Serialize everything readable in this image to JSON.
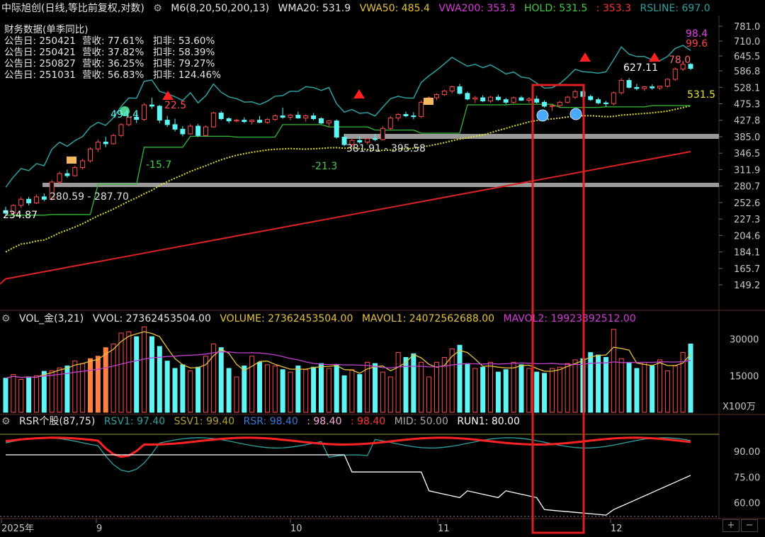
{
  "colors": {
    "up": "#ff4d4d",
    "down": "#5ff5f5",
    "wma20": "#dddd33",
    "vwa50": "#e6c33a",
    "vwa200": "#d83adb",
    "hold": "#44cc44",
    "hold_line": "#33bb33",
    "rsline": "#2fa0a0",
    "ma200": "#dd2222",
    "highlight": "#e02020",
    "white": "#ffffff",
    "grey": "#9a9a9a"
  },
  "header": {
    "title": "中际旭创(日线,等比前复权,对数)",
    "indicator": "M6(8,20,50,200,13)",
    "wma20": "WMA20: 531.9",
    "vwa50": "VWA50: 485.4",
    "vwa200": "VWA200: 353.3",
    "hold": "HOLD: 531.5",
    "hold2": ": 353.3",
    "rsline": "RSLINE: 697.0"
  },
  "financial": {
    "title": "财务数据(单季同比)",
    "rows": [
      {
        "date": "公告日: 250421",
        "rev": "营收: 77.61%",
        "np": "扣非: 53.60%"
      },
      {
        "date": "公告日: 250421",
        "rev": "营收: 37.82%",
        "np": "扣非: 58.39%"
      },
      {
        "date": "公告日: 250827",
        "rev": "营收: 36.25%",
        "np": "扣非: 79.27%"
      },
      {
        "date": "公告日: 251031",
        "rev": "营收: 56.83%",
        "np": "扣非: 124.46%"
      }
    ]
  },
  "volume_header": {
    "label": "VOL_金(3,21)",
    "vvol": "VVOL: 27362453504.00",
    "volume": "VOLUME: 27362453504.00",
    "mavol1": "MAVOL1: 24072562688.00",
    "mavol2": "MAVOL2: 19923392512.00"
  },
  "rsr_header": {
    "label": "RSR个股(87,75)",
    "rsv1": "RSV1: 97.40",
    "ssv1": "SSV1: 99.40",
    "rsr": "RSR: 98.40",
    "v4": ": 98.40",
    "v5": ": 98.40",
    "mid": "MID: 50.00",
    "run1": "RUN1: 80.00"
  },
  "price_axis": [
    "781.0",
    "710.0",
    "645.5",
    "586.8",
    "528.1",
    "475.3",
    "427.8",
    "385.0",
    "346.5",
    "311.9",
    "280.7",
    "252.6",
    "227.3",
    "204.6",
    "184.1",
    "165.7",
    "149.2"
  ],
  "vol_axis": [
    "30000",
    "15000"
  ],
  "vol_unit": "X100万",
  "rsr_axis": [
    "90.00",
    "75.00",
    "60.00"
  ],
  "date_axis": [
    "2025年",
    "9",
    "10",
    "11",
    "12"
  ],
  "nav_buttons": [
    "+",
    "−"
  ],
  "annotations": {
    "low_start": "234.87",
    "zone1": "280.59 - 287.70",
    "zone2": "381.91 - 395.58",
    "high_627": "627.11",
    "hold_val": "531.5",
    "rs98": "98.4",
    "rs99": "99.6",
    "v780": "78.0",
    "v224": "22.5",
    "v494": "494.4",
    "n157": "-15.7",
    "n213": "-21.3"
  },
  "chart_data": [
    {
      "type": "candlestick",
      "title": "中际旭创(日线,等比前复权,对数)",
      "scale": "log",
      "ylim": [
        140,
        790
      ],
      "x": [
        "2025-08-01",
        "2025-08-04",
        "2025-08-05",
        "2025-08-06",
        "2025-08-07",
        "2025-08-08",
        "2025-08-11",
        "2025-08-12",
        "2025-08-13",
        "2025-08-14",
        "2025-08-15",
        "2025-08-18",
        "2025-08-19",
        "2025-08-20",
        "2025-08-21",
        "2025-08-22",
        "2025-08-25",
        "2025-08-26",
        "2025-08-27",
        "2025-08-28",
        "2025-08-29",
        "2025-09-01",
        "2025-09-02",
        "2025-09-03",
        "2025-09-04",
        "2025-09-05",
        "2025-09-08",
        "2025-09-09",
        "2025-09-10",
        "2025-09-11",
        "2025-09-12",
        "2025-09-15",
        "2025-09-16",
        "2025-09-17",
        "2025-09-18",
        "2025-09-19",
        "2025-09-22",
        "2025-09-23",
        "2025-09-24",
        "2025-09-25",
        "2025-09-26",
        "2025-09-29",
        "2025-09-30",
        "2025-10-09",
        "2025-10-10",
        "2025-10-13",
        "2025-10-14",
        "2025-10-15",
        "2025-10-16",
        "2025-10-17",
        "2025-10-20",
        "2025-10-21",
        "2025-10-22",
        "2025-10-23",
        "2025-10-24",
        "2025-10-27",
        "2025-10-28",
        "2025-10-29",
        "2025-10-30",
        "2025-10-31",
        "2025-11-03",
        "2025-11-04",
        "2025-11-05",
        "2025-11-06",
        "2025-11-07",
        "2025-11-10",
        "2025-11-11",
        "2025-11-12",
        "2025-11-13",
        "2025-11-14",
        "2025-11-17",
        "2025-11-18",
        "2025-11-19",
        "2025-11-20",
        "2025-11-21",
        "2025-11-24",
        "2025-11-25",
        "2025-11-26",
        "2025-11-27",
        "2025-11-28",
        "2025-12-01",
        "2025-12-02",
        "2025-12-03",
        "2025-12-04",
        "2025-12-05",
        "2025-12-08",
        "2025-12-09",
        "2025-12-10",
        "2025-12-11",
        "2025-12-12"
      ],
      "ohlc": [
        [
          240,
          246,
          233,
          236
        ],
        [
          236,
          250,
          234,
          248
        ],
        [
          248,
          262,
          244,
          258
        ],
        [
          258,
          262,
          248,
          252
        ],
        [
          252,
          266,
          250,
          262
        ],
        [
          262,
          268,
          255,
          258
        ],
        [
          258,
          292,
          256,
          288
        ],
        [
          288,
          308,
          284,
          304
        ],
        [
          304,
          312,
          296,
          300
        ],
        [
          300,
          320,
          298,
          316
        ],
        [
          316,
          335,
          312,
          330
        ],
        [
          330,
          360,
          326,
          356
        ],
        [
          356,
          378,
          350,
          372
        ],
        [
          372,
          385,
          360,
          368
        ],
        [
          368,
          392,
          366,
          388
        ],
        [
          388,
          420,
          384,
          416
        ],
        [
          416,
          440,
          412,
          436
        ],
        [
          436,
          450,
          420,
          430
        ],
        [
          430,
          478,
          426,
          472
        ],
        [
          472,
          494,
          460,
          468
        ],
        [
          468,
          472,
          420,
          428
        ],
        [
          428,
          440,
          410,
          416
        ],
        [
          416,
          432,
          398,
          404
        ],
        [
          404,
          412,
          386,
          392
        ],
        [
          392,
          418,
          390,
          412
        ],
        [
          412,
          418,
          384,
          388
        ],
        [
          388,
          414,
          386,
          410
        ],
        [
          410,
          452,
          408,
          448
        ],
        [
          448,
          454,
          428,
          432
        ],
        [
          432,
          436,
          420,
          426
        ],
        [
          426,
          432,
          422,
          428
        ],
        [
          428,
          436,
          420,
          424
        ],
        [
          424,
          430,
          416,
          428
        ],
        [
          428,
          440,
          420,
          422
        ],
        [
          422,
          434,
          418,
          430
        ],
        [
          430,
          444,
          426,
          440
        ],
        [
          440,
          464,
          432,
          436
        ],
        [
          436,
          446,
          428,
          442
        ],
        [
          442,
          452,
          432,
          434
        ],
        [
          434,
          444,
          424,
          440
        ],
        [
          440,
          448,
          428,
          432
        ],
        [
          432,
          436,
          418,
          420
        ],
        [
          420,
          428,
          410,
          426
        ],
        [
          426,
          430,
          380,
          384
        ],
        [
          384,
          392,
          362,
          366
        ],
        [
          366,
          380,
          360,
          376
        ],
        [
          376,
          386,
          368,
          372
        ],
        [
          372,
          382,
          366,
          380
        ],
        [
          380,
          392,
          374,
          378
        ],
        [
          378,
          412,
          376,
          406
        ],
        [
          406,
          440,
          402,
          434
        ],
        [
          434,
          448,
          426,
          444
        ],
        [
          444,
          452,
          436,
          440
        ],
        [
          440,
          450,
          430,
          438
        ],
        [
          438,
          486,
          434,
          480
        ],
        [
          480,
          498,
          472,
          494
        ],
        [
          494,
          508,
          486,
          504
        ],
        [
          504,
          520,
          500,
          516
        ],
        [
          516,
          534,
          508,
          530
        ],
        [
          530,
          540,
          504,
          508
        ],
        [
          508,
          514,
          486,
          490
        ],
        [
          490,
          500,
          478,
          494
        ],
        [
          494,
          502,
          480,
          484
        ],
        [
          484,
          500,
          478,
          496
        ],
        [
          496,
          504,
          484,
          488
        ],
        [
          488,
          494,
          474,
          480
        ],
        [
          480,
          498,
          476,
          494
        ],
        [
          494,
          500,
          484,
          486
        ],
        [
          486,
          496,
          478,
          490
        ],
        [
          490,
          500,
          476,
          480
        ],
        [
          480,
          486,
          464,
          468
        ],
        [
          468,
          474,
          454,
          470
        ],
        [
          470,
          484,
          464,
          480
        ],
        [
          480,
          500,
          476,
          496
        ],
        [
          496,
          520,
          490,
          514
        ],
        [
          514,
          522,
          492,
          498
        ],
        [
          498,
          504,
          484,
          488
        ],
        [
          488,
          494,
          474,
          478
        ],
        [
          478,
          484,
          466,
          476
        ],
        [
          476,
          514,
          470,
          510
        ],
        [
          510,
          560,
          504,
          552
        ],
        [
          552,
          560,
          524,
          528
        ],
        [
          528,
          540,
          518,
          524
        ],
        [
          524,
          532,
          516,
          530
        ],
        [
          530,
          538,
          520,
          526
        ],
        [
          526,
          534,
          520,
          532
        ],
        [
          532,
          560,
          528,
          556
        ],
        [
          556,
          600,
          550,
          594
        ],
        [
          594,
          627,
          586,
          612
        ],
        [
          612,
          618,
          590,
          596
        ]
      ],
      "volume": [
        14000,
        15500,
        13500,
        14500,
        15000,
        16800,
        17000,
        18200,
        19000,
        21000,
        20000,
        22000,
        23000,
        26500,
        28000,
        32500,
        33000,
        31000,
        35000,
        31000,
        27000,
        21000,
        18000,
        19500,
        17000,
        18500,
        23000,
        28000,
        26500,
        18000,
        14500,
        19000,
        23000,
        20500,
        19500,
        19000,
        17500,
        16500,
        19000,
        17500,
        18500,
        20000,
        18000,
        19500,
        15000,
        17500,
        15500,
        20500,
        20000,
        16500,
        14500,
        24500,
        22500,
        24000,
        20500,
        14500,
        20500,
        22500,
        26000,
        27500,
        20000,
        18000,
        18500,
        20500,
        16500,
        17500,
        20500,
        19500,
        18000,
        16500,
        16000,
        18000,
        18500,
        20000,
        21500,
        22000,
        24500,
        23500,
        22500,
        34000,
        22000,
        20500,
        18000,
        20500,
        19000,
        21500,
        17000,
        19000,
        24500,
        28000
      ],
      "ylabel": ""
    },
    {
      "type": "line",
      "title": "RSR个股(87,75)",
      "ylim": [
        45,
        100
      ],
      "series": [
        {
          "name": "RSV1",
          "values": [
            97.4
          ]
        },
        {
          "name": "SSV1",
          "values": [
            99.4
          ]
        },
        {
          "name": "RSR",
          "values": [
            98.4
          ]
        },
        {
          "name": "MID",
          "values": [
            50.0
          ]
        },
        {
          "name": "RUN1",
          "values": [
            80.0
          ]
        }
      ]
    }
  ]
}
